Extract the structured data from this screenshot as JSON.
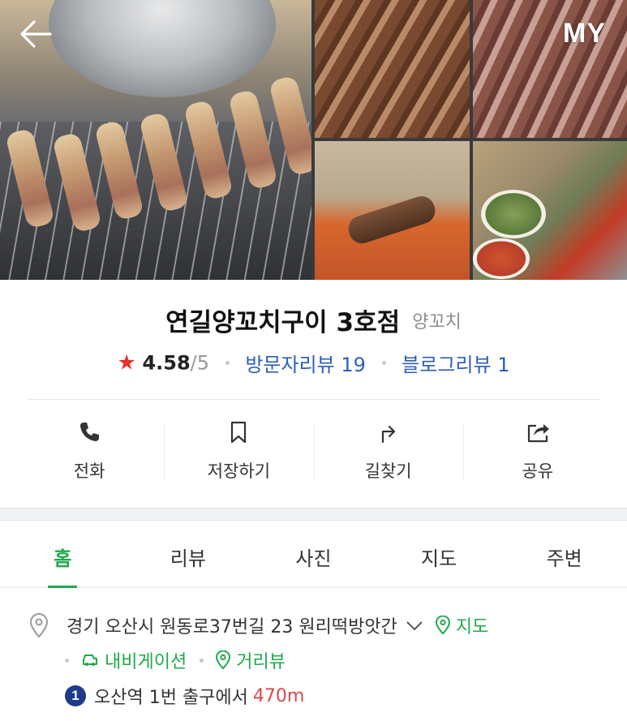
{
  "header": {
    "my_label": "MY"
  },
  "place": {
    "name": "연길양꼬치구이 3호점",
    "category": "양꼬치",
    "rating": "4.58",
    "rating_max": "/5",
    "visitor_reviews": "방문자리뷰 19",
    "blog_reviews": "블로그리뷰 1"
  },
  "actions": [
    {
      "label": "전화",
      "icon": "phone-icon"
    },
    {
      "label": "저장하기",
      "icon": "bookmark-icon"
    },
    {
      "label": "길찾기",
      "icon": "directions-icon"
    },
    {
      "label": "공유",
      "icon": "share-icon"
    }
  ],
  "tabs": [
    "홈",
    "리뷰",
    "사진",
    "지도",
    "주변"
  ],
  "info": {
    "address": "경기 오산시 원동로37번길 23 원리떡방앗간",
    "map_link": "지도",
    "navigation_link": "내비게이션",
    "street_view_link": "거리뷰",
    "subway_line": "1",
    "subway_text": "오산역 1번 출구에서",
    "subway_distance": "470m"
  },
  "colors": {
    "accent_green": "#1fa94a",
    "link_blue": "#2c5fb8",
    "star_red": "#e5312f",
    "distance_red": "#d94a4a",
    "line1_blue": "#1f3a8a"
  }
}
